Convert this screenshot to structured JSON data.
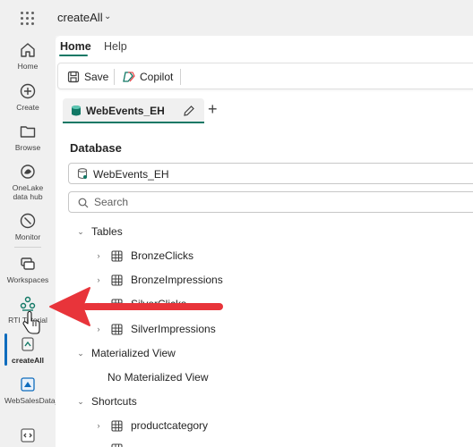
{
  "header": {
    "app_title": "createAll"
  },
  "rail": {
    "items": [
      {
        "label": "Home"
      },
      {
        "label": "Create"
      },
      {
        "label": "Browse"
      },
      {
        "label": "OneLake data hub"
      },
      {
        "label": "Monitor"
      },
      {
        "label": "Workspaces"
      },
      {
        "label": "RTI Tutorial"
      },
      {
        "label": "createAll"
      },
      {
        "label": "WebSalesData_LH"
      }
    ]
  },
  "ribbon": {
    "tabs": [
      "Home",
      "Help"
    ],
    "save_label": "Save",
    "copilot_label": "Copilot"
  },
  "doc_tab": {
    "label": "WebEvents_EH"
  },
  "database": {
    "heading": "Database",
    "selected": "WebEvents_EH",
    "search_placeholder": "Search"
  },
  "tree": {
    "tables_label": "Tables",
    "tables": [
      "BronzeClicks",
      "BronzeImpressions",
      "SilverClicks",
      "SilverImpressions"
    ],
    "mv_label": "Materialized View",
    "mv_empty": "No Materialized View",
    "shortcuts_label": "Shortcuts",
    "shortcuts": [
      "productcategory"
    ]
  },
  "colors": {
    "accent": "#117865",
    "annotation_arrow": "#e8343a",
    "rail_active": "#0f6cbd"
  }
}
